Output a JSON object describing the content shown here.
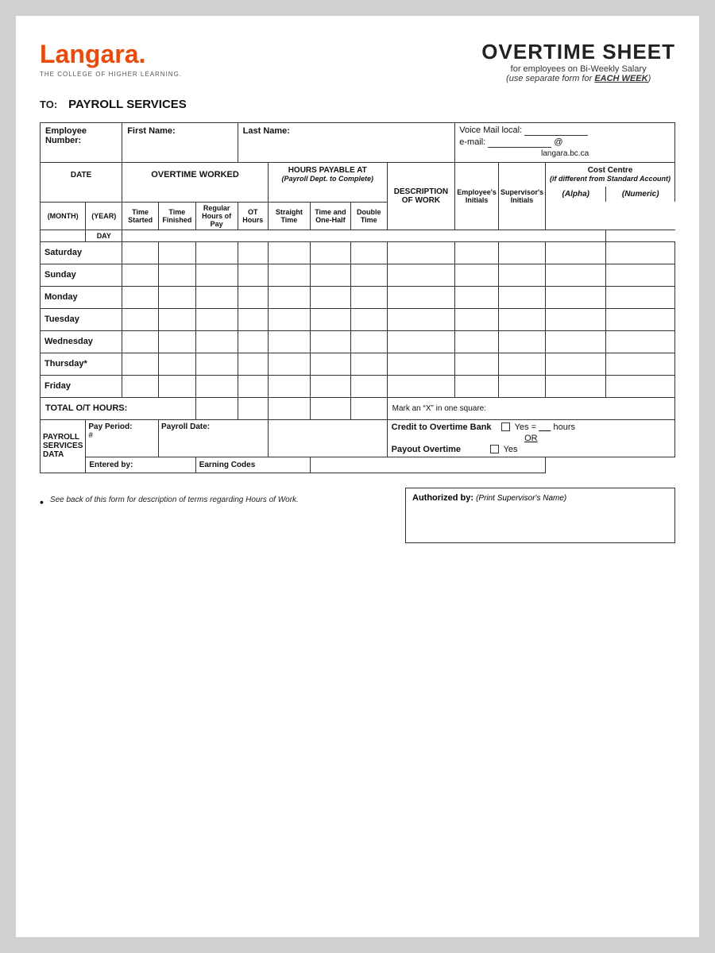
{
  "page": {
    "background": "white",
    "logo": {
      "text": "Langara.",
      "tagline": "THE COLLEGE OF HIGHER LEARNING."
    },
    "title": {
      "main": "OVERTIME SHEET",
      "sub1": "for employees on Bi-Weekly Salary",
      "sub2": "(use separate form for EACH WEEK)"
    },
    "to_label": "TO:",
    "to_value": "PAYROLL SERVICES",
    "info_fields": {
      "employee_number": "Employee Number:",
      "first_name": "First Name:",
      "last_name": "Last Name:",
      "voicemail": "Voice Mail local:",
      "email": "e-mail:",
      "at": "@",
      "domain": "langara.bc.ca"
    },
    "col_headers": {
      "date": "DATE",
      "overtime_worked": "OVERTIME WORKED",
      "hours_payable": "HOURS PAYABLE AT",
      "hours_payable_sub": "(Payroll Dept. to Complete)",
      "description": "DESCRIPTION",
      "of_work": "OF WORK",
      "employee_initials": "Employee's Initials",
      "supervisor_initials": "Supervisor's Initials",
      "cost_centre": "Cost Centre",
      "cost_centre_sub": "(if different from Standard Account)",
      "alpha": "(Alpha)",
      "numeric": "(Numeric)"
    },
    "sub_headers": {
      "month": "(MONTH)",
      "year": "(YEAR)",
      "day": "DAY",
      "time_started": "Time Started",
      "time_finished": "Time Finished",
      "regular_hours": "Regular Hours of Pay",
      "ot_hours": "OT Hours",
      "straight_time": "Straight Time",
      "time_and_half": "Time and One-Half",
      "double_time": "Double Time"
    },
    "days": [
      "Saturday",
      "Sunday",
      "Monday",
      "Tuesday",
      "Wednesday",
      "Thursday*",
      "Friday"
    ],
    "total_label": "TOTAL O/T HOURS:",
    "payroll_section": {
      "label1": "PAYROLL",
      "label2": "SERVICES",
      "label3": "DATA",
      "pay_period_label": "Pay Period:",
      "pay_period_sub": "#",
      "payroll_date_label": "Payroll Date:",
      "entered_by": "Entered by:",
      "earning_codes": "Earning Codes"
    },
    "right_section": {
      "mark_text": "Mark an “X” in one square:",
      "credit_label": "Credit to Overtime Bank",
      "yes_label": "Yes =",
      "hours_label": "hours",
      "or_label": "OR",
      "payout_label": "Payout Overtime",
      "payout_yes": "Yes"
    },
    "footer": {
      "note": "See back of this form for description of terms regarding Hours of Work.",
      "authorized_label": "Authorized by:",
      "authorized_sub": "(Print Supervisor's Name)"
    }
  }
}
